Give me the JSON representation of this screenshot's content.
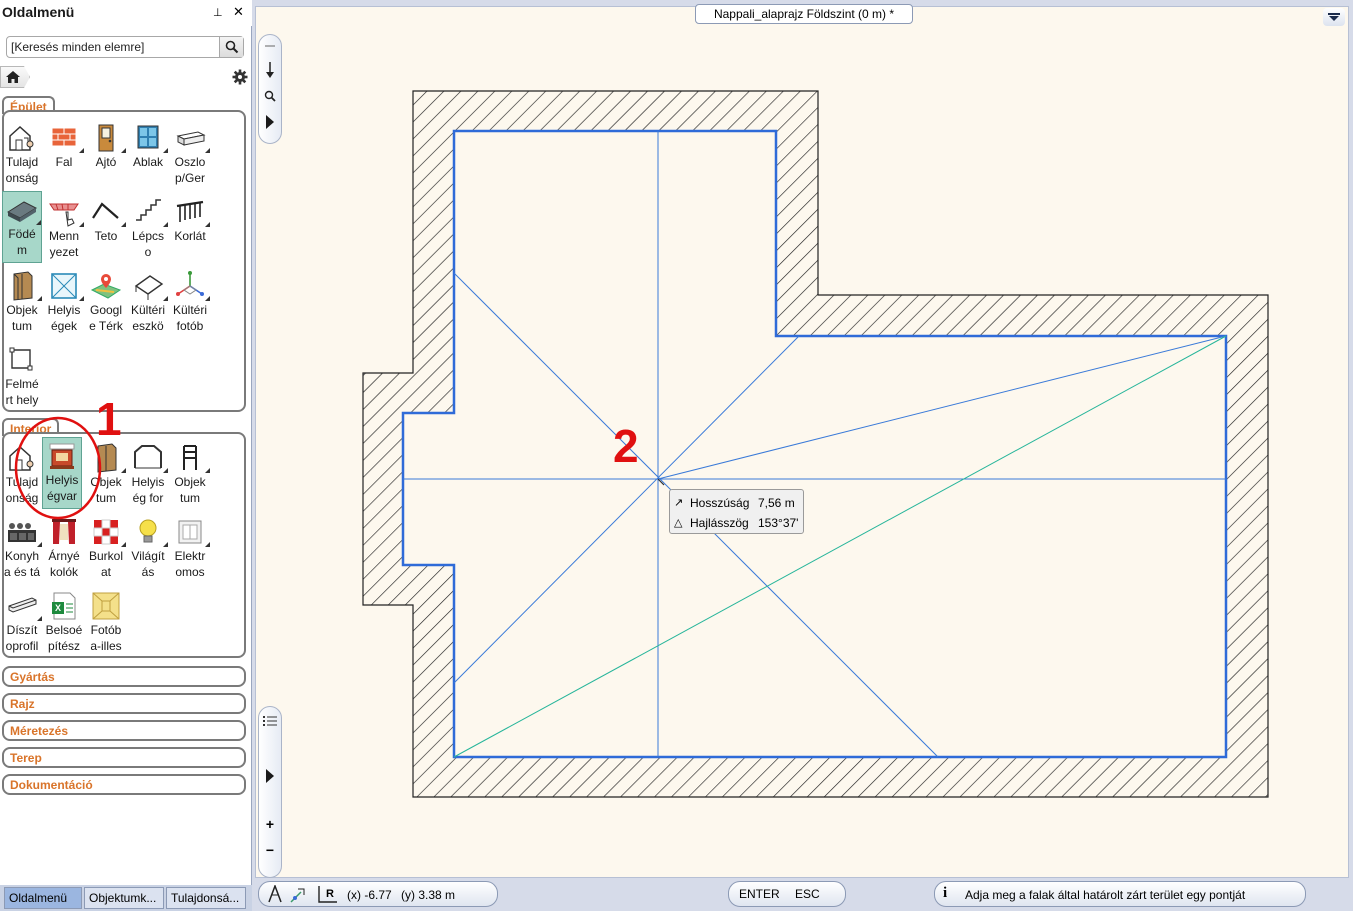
{
  "sidebar": {
    "title": "Oldalmenü",
    "pin_glyph": "⊥",
    "close_glyph": "✕",
    "search": {
      "placeholder": "[Keresés minden elemre]"
    },
    "groups": {
      "epulet": {
        "label": "Épület",
        "tools": [
          {
            "label": "Tulajd\nonság"
          },
          {
            "label": "Fal"
          },
          {
            "label": "Ajtó"
          },
          {
            "label": "Ablak"
          },
          {
            "label": "Oszlo\np/Ger"
          },
          {
            "label": "Födé\nm"
          },
          {
            "label": "Menn\nyezet"
          },
          {
            "label": "Teto"
          },
          {
            "label": "Lépcs\no"
          },
          {
            "label": "Korlát"
          },
          {
            "label": "Objek\ntum"
          },
          {
            "label": "Helyis\négek"
          },
          {
            "label": "Googl\ne Térk"
          },
          {
            "label": "Kültéri\neszkö"
          },
          {
            "label": "Kültéri\nfotób"
          },
          {
            "label": "Felmé\nrt hely"
          }
        ]
      },
      "interior": {
        "label": "Interior",
        "tools": [
          {
            "label": "Tulajd\nonság"
          },
          {
            "label": "Helyis\négvar"
          },
          {
            "label": "Objek\ntum"
          },
          {
            "label": "Helyis\nég for"
          },
          {
            "label": "Objek\ntum"
          },
          {
            "label": "Konyh\na és tá"
          },
          {
            "label": "Árnyé\nkolók"
          },
          {
            "label": "Burkol\nat"
          },
          {
            "label": "Világít\nás"
          },
          {
            "label": "Elektr\nomos"
          },
          {
            "label": "Díszít\noprofil"
          },
          {
            "label": "Belsoé\npítész"
          },
          {
            "label": "Fotób\na-illes"
          }
        ]
      }
    },
    "collapsed": [
      "Gyártás",
      "Rajz",
      "Méretezés",
      "Terep",
      "Dokumentáció"
    ],
    "bottom_tabs": [
      "Oldalmenü",
      "Objektumk...",
      "Tulajdonsá..."
    ]
  },
  "document": {
    "tab_title": "Nappali_alaprajz Földszint (0 m) *"
  },
  "tooltip": {
    "length_label": "Hosszúság",
    "length_value": "7,56 m",
    "angle_label": "Hajlásszög",
    "angle_value": "153°37'"
  },
  "callouts": {
    "one": "1",
    "two": "2"
  },
  "status": {
    "coord_x": "(x) -6.77",
    "coord_y": "(y) 3.38 m",
    "enter": "ENTER",
    "esc": "ESC",
    "hint": "Adja meg a falak által határolt zárt terület egy pontját"
  },
  "colors": {
    "accent_orange": "#d9742a",
    "selection": "#a7d7c9",
    "wall_inner": "#2f6bd8",
    "guide_line": "#3a7ad8",
    "diagonal": "#26b59a",
    "callout_red": "#e01010",
    "canvas_bg": "#fdf8ee"
  }
}
